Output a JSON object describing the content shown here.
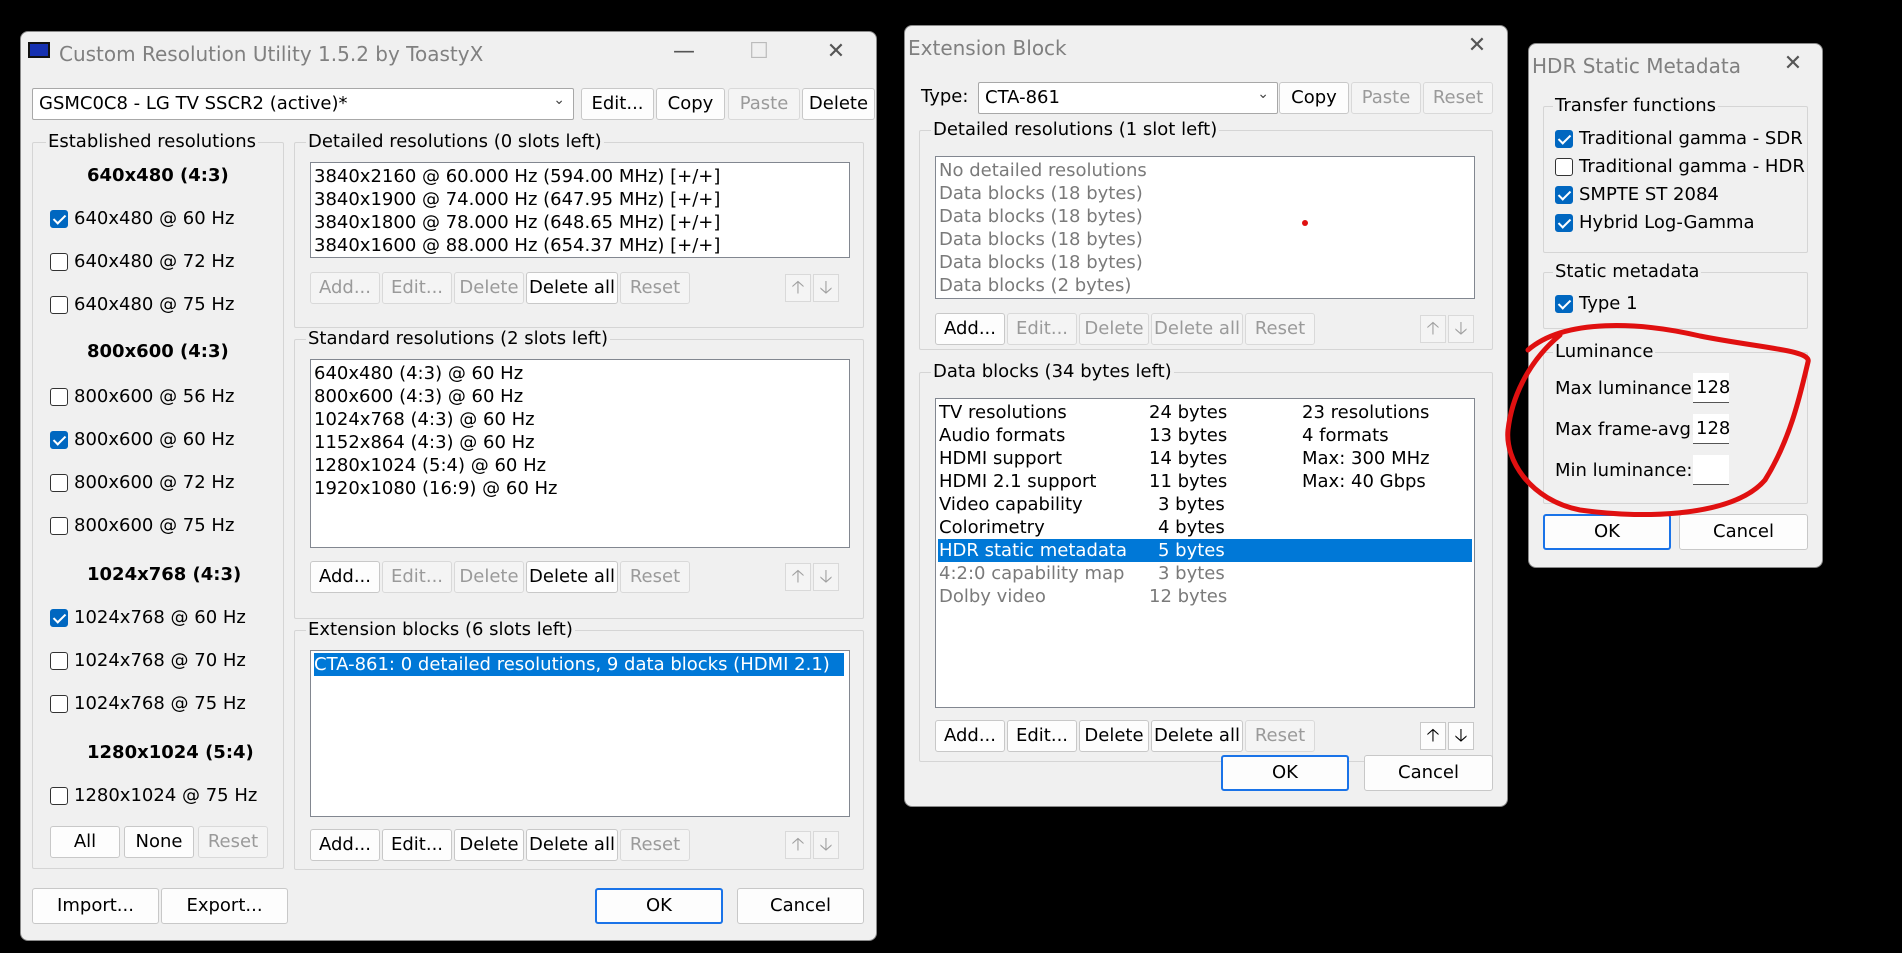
{
  "cru": {
    "title": "Custom Resolution Utility 1.5.2 by ToastyX",
    "monitor": "GSMC0C8 - LG TV SSCR2 (active)*",
    "top_buttons": {
      "edit": "Edit...",
      "copy": "Copy",
      "paste": "Paste",
      "delete": "Delete"
    },
    "established": {
      "label": "Established resolutions",
      "groups": [
        {
          "header": "640x480 (4:3)",
          "items": [
            {
              "label": "640x480 @ 60 Hz",
              "checked": true
            },
            {
              "label": "640x480 @ 72 Hz",
              "checked": false
            },
            {
              "label": "640x480 @ 75 Hz",
              "checked": false
            }
          ]
        },
        {
          "header": "800x600 (4:3)",
          "items": [
            {
              "label": "800x600 @ 56 Hz",
              "checked": false
            },
            {
              "label": "800x600 @ 60 Hz",
              "checked": true
            },
            {
              "label": "800x600 @ 72 Hz",
              "checked": false
            },
            {
              "label": "800x600 @ 75 Hz",
              "checked": false
            }
          ]
        },
        {
          "header": "1024x768 (4:3)",
          "items": [
            {
              "label": "1024x768 @ 60 Hz",
              "checked": true
            },
            {
              "label": "1024x768 @ 70 Hz",
              "checked": false
            },
            {
              "label": "1024x768 @ 75 Hz",
              "checked": false
            }
          ]
        },
        {
          "header": "1280x1024 (5:4)",
          "items": [
            {
              "label": "1280x1024 @ 75 Hz",
              "checked": false
            }
          ]
        }
      ],
      "buttons": {
        "all": "All",
        "none": "None",
        "reset": "Reset"
      }
    },
    "detailed": {
      "label": "Detailed resolutions (0 slots left)",
      "items": [
        "3840x2160 @ 60.000 Hz (594.00 MHz) [+/+]",
        "3840x1900 @ 74.000 Hz (647.95 MHz) [+/+]",
        "3840x1800 @ 78.000 Hz (648.65 MHz) [+/+]",
        "3840x1600 @ 88.000 Hz (654.37 MHz) [+/+]"
      ]
    },
    "standard": {
      "label": "Standard resolutions (2 slots left)",
      "items": [
        "640x480 (4:3) @ 60 Hz",
        "800x600 (4:3) @ 60 Hz",
        "1024x768 (4:3) @ 60 Hz",
        "1152x864 (4:3) @ 60 Hz",
        "1280x1024 (5:4) @ 60 Hz",
        "1920x1080 (16:9) @ 60 Hz"
      ]
    },
    "extension": {
      "label": "Extension blocks (6 slots left)",
      "items": [
        "CTA-861: 0 detailed resolutions, 9 data blocks (HDMI 2.1)"
      ]
    },
    "list_buttons": {
      "add": "Add...",
      "edit": "Edit...",
      "delete": "Delete",
      "delete_all": "Delete all",
      "reset": "Reset"
    },
    "bottom": {
      "import": "Import...",
      "export": "Export...",
      "ok": "OK",
      "cancel": "Cancel"
    }
  },
  "ext": {
    "title": "Extension Block",
    "type_label": "Type:",
    "type_value": "CTA-861",
    "top_buttons": {
      "copy": "Copy",
      "paste": "Paste",
      "reset": "Reset"
    },
    "detailed": {
      "label": "Detailed resolutions (1 slot left)",
      "items": [
        "No detailed resolutions",
        "Data blocks (18 bytes)",
        "Data blocks (18 bytes)",
        "Data blocks (18 bytes)",
        "Data blocks (18 bytes)",
        "Data blocks (2 bytes)"
      ]
    },
    "datablocks": {
      "label": "Data blocks (34 bytes left)",
      "rows": [
        {
          "name": "TV resolutions",
          "size": "24 bytes",
          "info": "23 resolutions"
        },
        {
          "name": "Audio formats",
          "size": "13 bytes",
          "info": "4 formats"
        },
        {
          "name": "HDMI support",
          "size": "14 bytes",
          "info": "Max: 300 MHz"
        },
        {
          "name": "HDMI 2.1 support",
          "size": "11 bytes",
          "info": "Max: 40 Gbps"
        },
        {
          "name": "Video capability",
          "size": "3 bytes",
          "info": ""
        },
        {
          "name": "Colorimetry",
          "size": "4 bytes",
          "info": ""
        },
        {
          "name": "HDR static metadata",
          "size": "5 bytes",
          "info": ""
        },
        {
          "name": "4:2:0 capability map",
          "size": "3 bytes",
          "info": ""
        },
        {
          "name": "Dolby video",
          "size": "12 bytes",
          "info": ""
        }
      ]
    },
    "list_buttons": {
      "add": "Add...",
      "edit": "Edit...",
      "delete": "Delete",
      "delete_all": "Delete all",
      "reset": "Reset"
    },
    "bottom": {
      "ok": "OK",
      "cancel": "Cancel"
    }
  },
  "hdr": {
    "title": "HDR Static Metadata",
    "transfer": {
      "label": "Transfer functions",
      "items": [
        {
          "label": "Traditional gamma - SDR",
          "checked": true
        },
        {
          "label": "Traditional gamma - HDR",
          "checked": false
        },
        {
          "label": "SMPTE ST 2084",
          "checked": true
        },
        {
          "label": "Hybrid Log-Gamma",
          "checked": true
        }
      ]
    },
    "static": {
      "label": "Static metadata",
      "items": [
        {
          "label": "Type 1",
          "checked": true
        }
      ]
    },
    "luminance": {
      "label": "Luminance",
      "max_label": "Max luminance:",
      "max_value": "128",
      "frame_label": "Max frame-avg:",
      "frame_value": "128",
      "min_label": "Min luminance:",
      "min_value": ""
    },
    "bottom": {
      "ok": "OK",
      "cancel": "Cancel"
    }
  },
  "annotation_color": "#e01010"
}
